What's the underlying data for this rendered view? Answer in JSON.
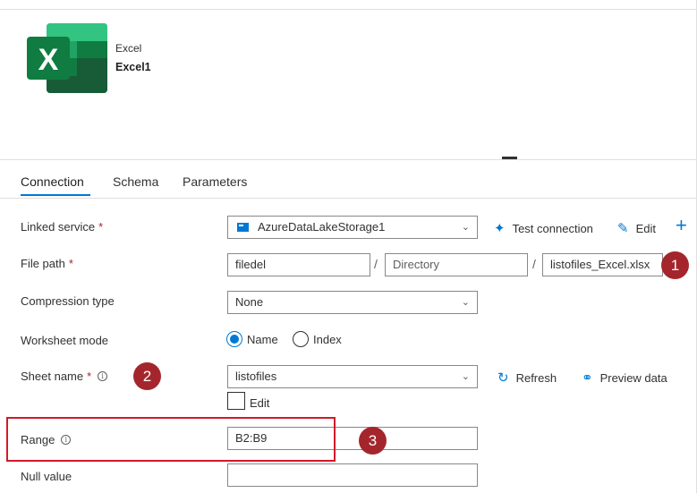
{
  "resource": {
    "type_label": "Excel",
    "name": "Excel1"
  },
  "tabs": [
    {
      "label": "Connection",
      "active": true
    },
    {
      "label": "Schema",
      "active": false
    },
    {
      "label": "Parameters",
      "active": false
    }
  ],
  "fields": {
    "linked_service": {
      "label": "Linked service",
      "required": "*",
      "value": "AzureDataLakeStorage1"
    },
    "file_path": {
      "label": "File path",
      "required": "*",
      "container": "filedel",
      "directory_placeholder": "Directory",
      "separator": "/",
      "file": "listofiles_Excel.xlsx"
    },
    "compression_type": {
      "label": "Compression type",
      "value": "None"
    },
    "worksheet_mode": {
      "label": "Worksheet mode",
      "options": [
        "Name",
        "Index"
      ],
      "selected": "Name"
    },
    "sheet_name": {
      "label": "Sheet name",
      "required": "*",
      "value": "listofiles",
      "edit_label": "Edit",
      "edit_checked": false
    },
    "range": {
      "label": "Range",
      "value": "B2:B9"
    },
    "null_value": {
      "label": "Null value",
      "value": ""
    }
  },
  "actions": {
    "test_connection": "Test connection",
    "edit": "Edit",
    "refresh": "Refresh",
    "preview_data": "Preview data"
  },
  "callouts": [
    "1",
    "2",
    "3"
  ],
  "colors": {
    "accent": "#0078d4",
    "callout": "#a4262c",
    "highlight": "#d11a2a",
    "excel_green": "#107c41"
  }
}
